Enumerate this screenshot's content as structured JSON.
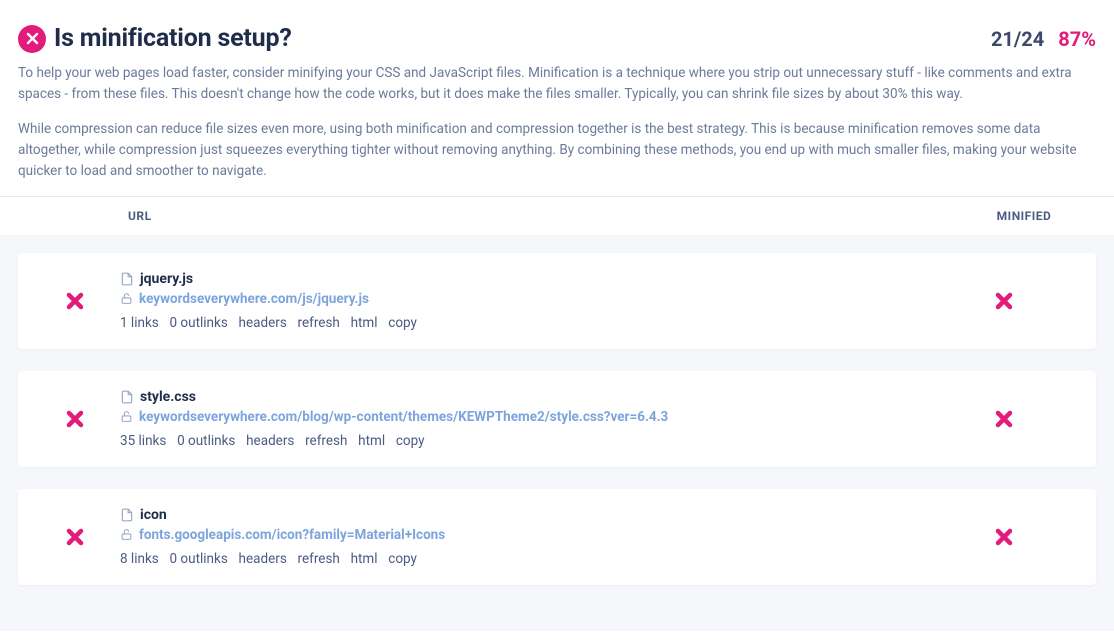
{
  "header": {
    "status": "fail",
    "title": "Is minification setup?",
    "score_count": "21/24",
    "score_pct": "87%",
    "desc1": "To help your web pages load faster, consider minifying your CSS and JavaScript files. Minification is a technique where you strip out unnecessary stuff - like comments and extra spaces - from these files. This doesn't change how the code works, but it does make the files smaller. Typically, you can shrink file sizes by about 30% this way.",
    "desc2": "While compression can reduce file sizes even more, using both minification and compression together is the best strategy. This is because minification removes some data altogether, while compression just squeezes everything tighter without removing anything. By combining these methods, you end up with much smaller files, making your website quicker to load and smoother to navigate."
  },
  "columns": {
    "url": "URL",
    "minified": "MINIFIED"
  },
  "rows": [
    {
      "filename": "jquery.js",
      "url": "keywordseverywhere.com/js/jquery.js",
      "links": "1 links",
      "outlinks": "0 outlinks"
    },
    {
      "filename": "style.css",
      "url": "keywordseverywhere.com/blog/wp-content/themes/KEWPTheme2/style.css?ver=6.4.3",
      "links": "35 links",
      "outlinks": "0 outlinks"
    },
    {
      "filename": "icon",
      "url": "fonts.googleapis.com/icon?family=Material+Icons",
      "links": "8 links",
      "outlinks": "0 outlinks"
    }
  ],
  "actions": {
    "headers": "headers",
    "refresh": "refresh",
    "html": "html",
    "copy": "copy"
  }
}
